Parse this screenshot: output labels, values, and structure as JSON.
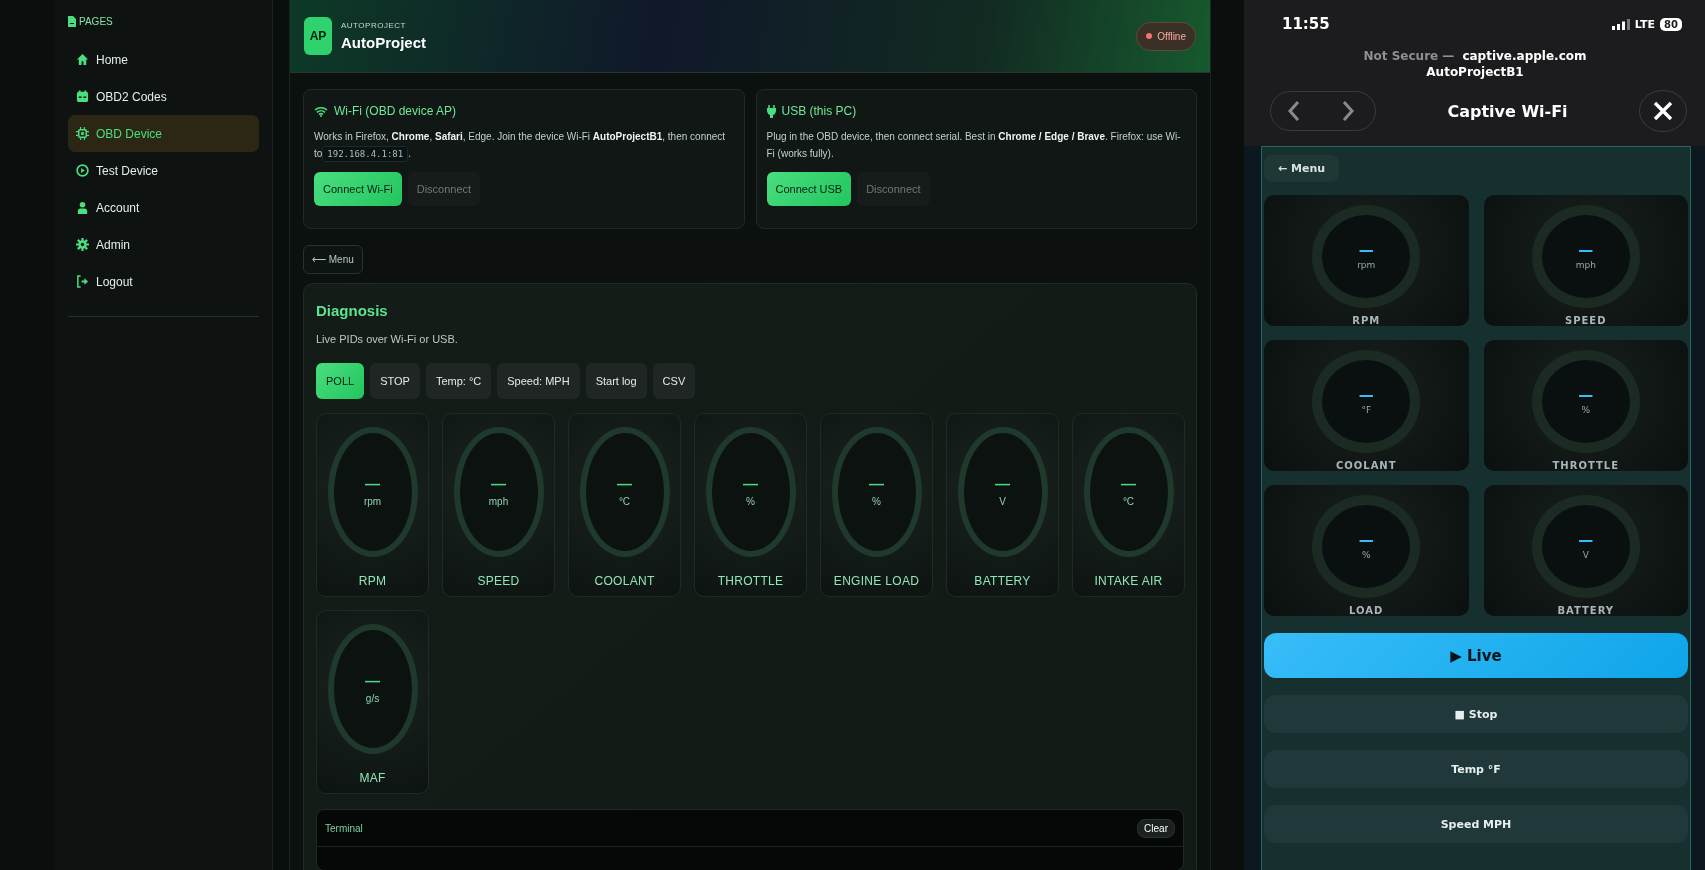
{
  "sidebar": {
    "heading": "PAGES",
    "items": [
      {
        "label": "Home",
        "selected": false
      },
      {
        "label": "OBD2 Codes",
        "selected": false
      },
      {
        "label": "OBD Device",
        "selected": true
      },
      {
        "label": "Test Device",
        "selected": false
      },
      {
        "label": "Account",
        "selected": false
      },
      {
        "label": "Admin",
        "selected": false
      },
      {
        "label": "Logout",
        "selected": false
      }
    ]
  },
  "header": {
    "logo": "AP",
    "eyebrow": "AUTOPROJECT",
    "title": "AutoProject",
    "status": "Offline",
    "online": false
  },
  "connections": [
    {
      "kind": "wifi",
      "title": "Wi-Fi (OBD device AP)",
      "text": "Works in Firefox, **Chrome**, **Safari**, Edge. Join the device Wi-Fi **AutoProjectB1**, then connect to",
      "code": "192.168.4.1:81",
      "text_after": ".",
      "buttons": [
        {
          "label": "Connect Wi-Fi",
          "kind": "primary"
        },
        {
          "label": "Disconnect",
          "kind": "muted"
        }
      ]
    },
    {
      "kind": "usb",
      "title": "USB (this PC)",
      "text": "Plug in the OBD device, then connect serial. Best in **Chrome / Edge / Brave**. Firefox: use Wi-Fi (works fully).",
      "buttons": [
        {
          "label": "Connect USB",
          "kind": "primary"
        },
        {
          "label": "Disconnect",
          "kind": "muted"
        }
      ]
    }
  ],
  "back_button": "⟵ Menu",
  "diagnosis": {
    "title": "Diagnosis",
    "subtitle": "Live PIDs over Wi-Fi or USB.",
    "buttons": [
      {
        "label": "POLL",
        "selected": true
      },
      {
        "label": "STOP",
        "selected": false
      },
      {
        "label": "Temp: °C",
        "selected": false
      },
      {
        "label": "Speed: MPH",
        "selected": false
      },
      {
        "label": "Start log",
        "selected": false
      },
      {
        "label": "CSV",
        "selected": false
      }
    ],
    "gauges": [
      {
        "value": "—",
        "unit": "rpm",
        "label": "RPM"
      },
      {
        "value": "—",
        "unit": "mph",
        "label": "SPEED"
      },
      {
        "value": "—",
        "unit": "°C",
        "label": "COOLANT"
      },
      {
        "value": "—",
        "unit": "%",
        "label": "THROTTLE"
      },
      {
        "value": "—",
        "unit": "%",
        "label": "ENGINE LOAD"
      },
      {
        "value": "—",
        "unit": "V",
        "label": "BATTERY"
      },
      {
        "value": "—",
        "unit": "°C",
        "label": "INTAKE AIR"
      },
      {
        "value": "—",
        "unit": "g/s",
        "label": "MAF"
      }
    ]
  },
  "terminal": {
    "title": "Terminal",
    "clear": "Clear"
  },
  "phone": {
    "time": "11:55",
    "network": "LTE",
    "battery": "80",
    "security": "Not Secure —",
    "host": "captive.apple.com",
    "ssid": "AutoProjectB1",
    "title": "Captive Wi-Fi",
    "back_button": "← Menu",
    "gauges": [
      {
        "value": "—",
        "unit": "rpm",
        "label": "RPM"
      },
      {
        "value": "—",
        "unit": "mph",
        "label": "SPEED"
      },
      {
        "value": "—",
        "unit": "°F",
        "label": "COOLANT"
      },
      {
        "value": "—",
        "unit": "%",
        "label": "THROTTLE"
      },
      {
        "value": "—",
        "unit": "%",
        "label": "LOAD"
      },
      {
        "value": "—",
        "unit": "V",
        "label": "BATTERY"
      }
    ],
    "buttons": [
      {
        "label": "▶ Live",
        "kind": "primary"
      },
      {
        "label": "■ Stop",
        "kind": "secondary"
      },
      {
        "label": "Temp °F",
        "kind": "secondary"
      },
      {
        "label": "Speed MPH",
        "kind": "secondary"
      }
    ]
  }
}
